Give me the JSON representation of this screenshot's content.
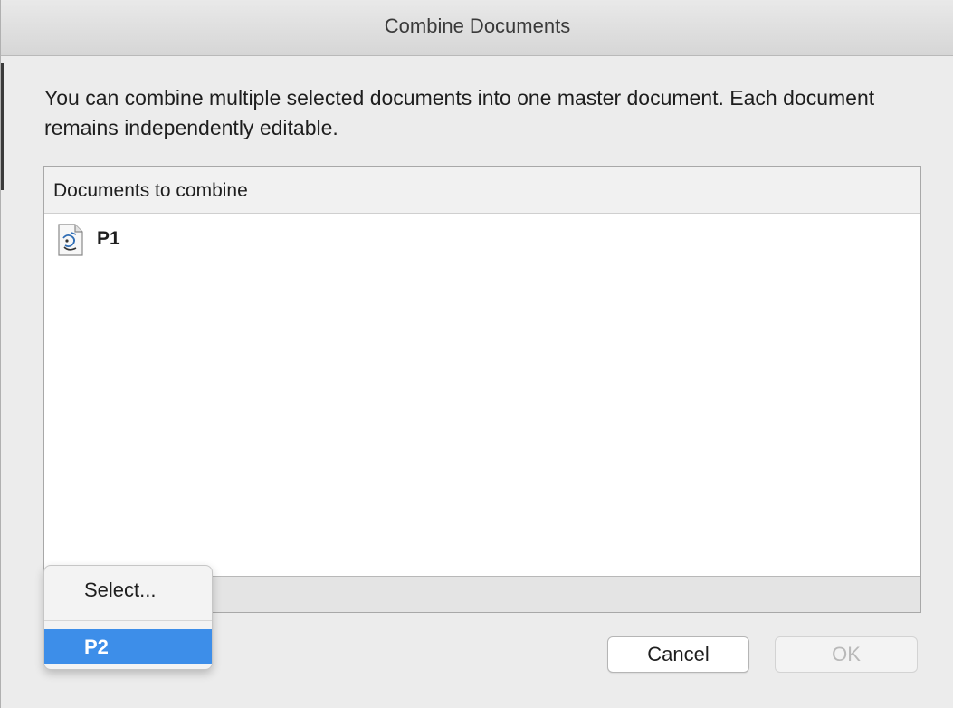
{
  "dialog": {
    "title": "Combine Documents",
    "description": "You can combine multiple selected documents into one master document. Each document remains independently editable."
  },
  "table": {
    "header": "Documents to combine",
    "rows": [
      {
        "label": "P1",
        "icon": "script-document-icon"
      }
    ]
  },
  "buttons": {
    "cancel_label": "Cancel",
    "ok_label": "OK"
  },
  "popup": {
    "select_label": "Select...",
    "highlighted_item": "P2",
    "highlight_color": "#3d8ee9"
  }
}
